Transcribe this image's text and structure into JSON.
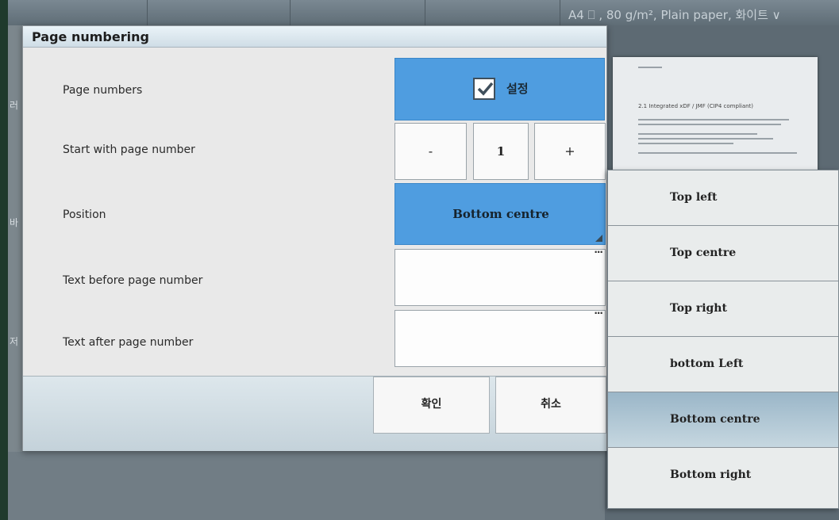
{
  "background": {
    "status_text": "A4 ⎕ , 80 g/m², Plain paper, 화이트 ∨",
    "side_chars": [
      "러",
      "바",
      "저"
    ],
    "doc_heading": "2.1 Integrated xDF / JMF (CIP4 compliant)"
  },
  "dialog": {
    "title": "Page numbering",
    "rows": {
      "page_numbers": {
        "label": "Page numbers",
        "checkbox_label": "설정",
        "checked": true
      },
      "start_number": {
        "label": "Start with page number",
        "minus": "-",
        "value": "1",
        "plus": "+"
      },
      "position": {
        "label": "Position",
        "value": "Bottom centre"
      },
      "text_before": {
        "label": "Text before page number",
        "value": "",
        "more": "···"
      },
      "text_after": {
        "label": "Text after page number",
        "value": "",
        "more": "···"
      }
    },
    "footer": {
      "ok_label": "확인",
      "cancel_label": "취소"
    }
  },
  "dropdown": {
    "selected_index": 4,
    "items": [
      "Top left",
      "Top centre",
      "Top right",
      "bottom Left",
      "Bottom centre",
      "Bottom right"
    ]
  },
  "colors": {
    "accent_blue": "#4f9de0",
    "selected_item": "#9ab6c8"
  }
}
